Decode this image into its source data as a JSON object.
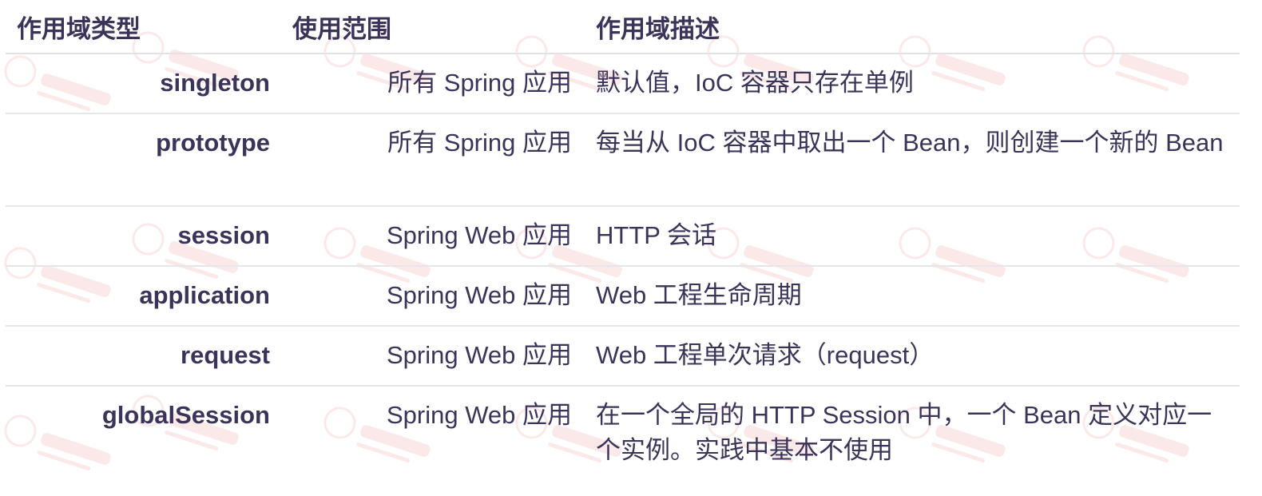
{
  "table": {
    "headers": {
      "scope": "作用域类型",
      "range": "使用范围",
      "desc": "作用域描述"
    },
    "rows": [
      {
        "scope": "singleton",
        "range": "所有 Spring 应用",
        "desc": "默认值，IoC 容器只存在单例"
      },
      {
        "scope": "prototype",
        "range": "所有 Spring 应用",
        "desc": "每当从 IoC 容器中取出一个 Bean，则创建一个新的 Bean"
      },
      {
        "scope": "session",
        "range": "Spring Web 应用",
        "desc": "HTTP 会话"
      },
      {
        "scope": "application",
        "range": "Spring Web 应用",
        "desc": "Web 工程生命周期"
      },
      {
        "scope": "request",
        "range": "Spring Web 应用",
        "desc": "Web 工程单次请求（request）"
      },
      {
        "scope": "globalSession",
        "range": "Spring Web 应用",
        "desc": "在一个全局的 HTTP Session 中，一个 Bean 定义对应一个实例。实践中基本不使用"
      }
    ]
  },
  "colors": {
    "text": "#3b3458",
    "divider": "#e6e6ea",
    "watermark": "#e05555"
  }
}
